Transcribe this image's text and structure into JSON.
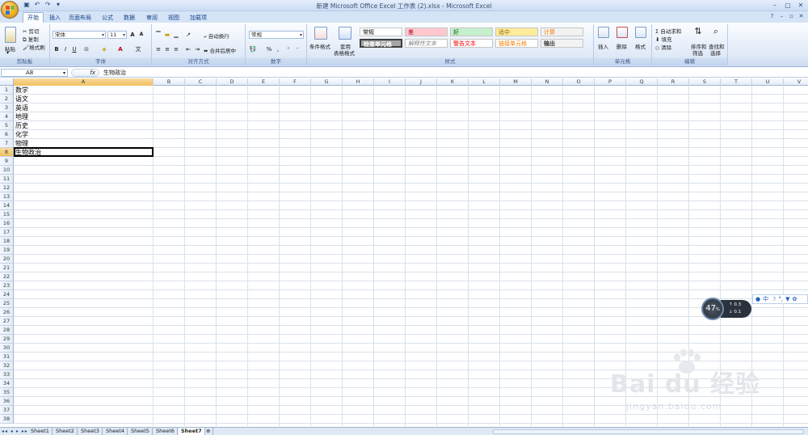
{
  "window": {
    "title": "新建 Microsoft Office Excel 工作表 (2).xlsx - Microsoft Excel"
  },
  "tabs": [
    "开始",
    "插入",
    "页面布局",
    "公式",
    "数据",
    "审阅",
    "视图",
    "加载项"
  ],
  "ribbon": {
    "clipboard": {
      "paste": "粘贴",
      "cut": "剪切",
      "copy": "复制",
      "format_painter": "格式刷",
      "label": "剪贴板"
    },
    "font": {
      "name": "宋体",
      "size": "11",
      "label": "字体"
    },
    "alignment": {
      "wrap": "自动换行",
      "merge": "合并后居中",
      "label": "对齐方式"
    },
    "number": {
      "format": "常规",
      "label": "数字"
    },
    "styles": {
      "conditional": "条件格式",
      "table": "套用",
      "table2": "表格格式",
      "label": "样式",
      "cells": [
        {
          "text": "常规",
          "bg": "#ffffff",
          "color": "#000000"
        },
        {
          "text": "差",
          "bg": "#ffc7ce",
          "color": "#9c0006"
        },
        {
          "text": "好",
          "bg": "#c6efce",
          "color": "#006100"
        },
        {
          "text": "适中",
          "bg": "#ffeb9c",
          "color": "#9c6500"
        },
        {
          "text": "计算",
          "bg": "#f2f2f2",
          "color": "#fa7d00"
        },
        {
          "text": "检查单元格",
          "bg": "#a5a5a5",
          "color": "#ffffff"
        },
        {
          "text": "解释性文本",
          "bg": "#ffffff",
          "color": "#7f7f7f"
        },
        {
          "text": "警告文本",
          "bg": "#ffffff",
          "color": "#ff0000"
        },
        {
          "text": "链接单元格",
          "bg": "#ffffff",
          "color": "#fa7d00"
        },
        {
          "text": "输出",
          "bg": "#f2f2f2",
          "color": "#3f3f3f"
        }
      ]
    },
    "cells": {
      "insert": "插入",
      "delete": "删除",
      "format": "格式",
      "label": "单元格"
    },
    "editing": {
      "autosum": "自动求和",
      "fill": "填充",
      "clear": "清除",
      "sort": "排序和",
      "sort2": "筛选",
      "find": "查找和",
      "find2": "选择",
      "label": "编辑"
    }
  },
  "formula_bar": {
    "name_box": "A8",
    "fx": "fx",
    "content": "生物政治"
  },
  "columns": [
    "A",
    "B",
    "C",
    "D",
    "E",
    "F",
    "G",
    "H",
    "I",
    "J",
    "K",
    "L",
    "M",
    "N",
    "O",
    "P",
    "Q",
    "R",
    "S",
    "T",
    "U",
    "V"
  ],
  "selected_column": "A",
  "row_count": 38,
  "selected_row": 8,
  "cell_values": [
    "数学",
    "语文",
    "英语",
    "地理",
    "历史",
    "化学",
    "物理",
    "生物政治"
  ],
  "sheets": [
    "Sheet1",
    "Sheet2",
    "Sheet3",
    "Sheet4",
    "Sheet5",
    "Sheet6",
    "Sheet7"
  ],
  "active_sheet": "Sheet7",
  "overlay": {
    "gauge_value": "47",
    "gauge_unit": "%",
    "up_rate": "0.3",
    "down_rate": "0.1"
  },
  "watermark": {
    "brand": "Bai  du 经验",
    "url": "jingyan.baidu.com"
  }
}
